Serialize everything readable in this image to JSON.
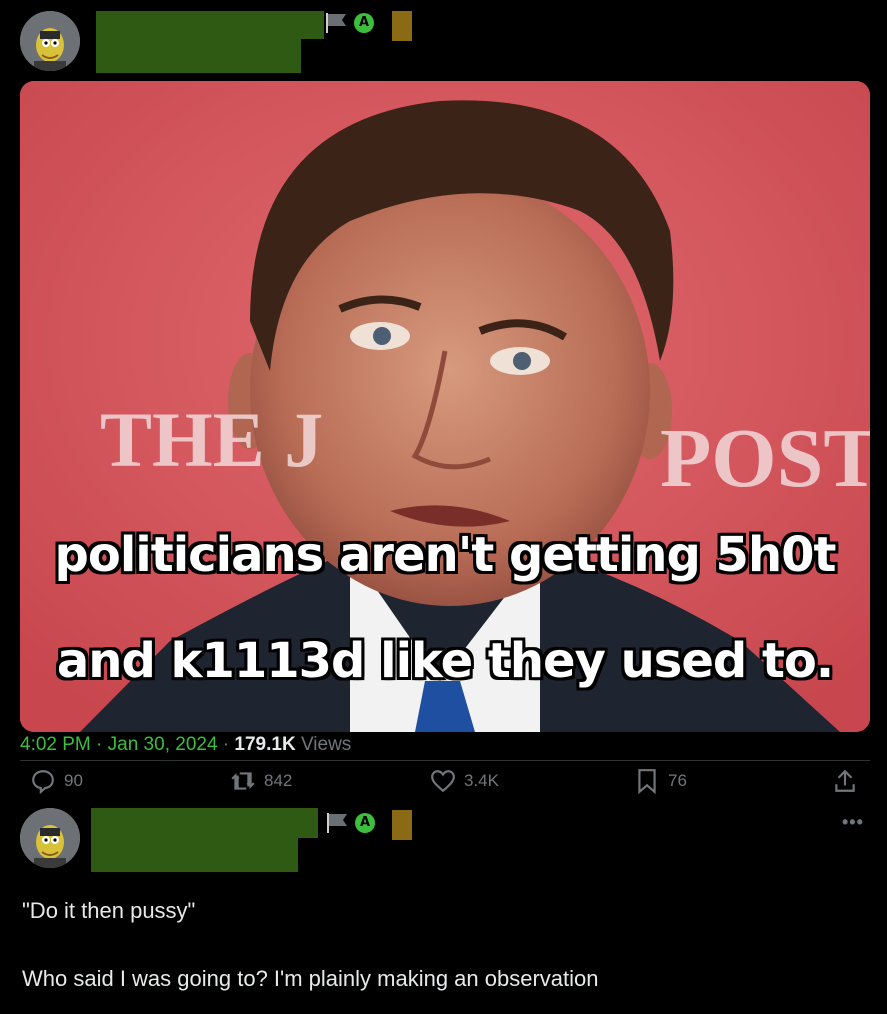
{
  "tweet": {
    "caption_line_1": "politicians aren't getting 5h0t",
    "caption_line_2": "and k1113d like they used to.",
    "timestamp": "4:02 PM · Jan 30, 2024",
    "views_count": "179.1K",
    "views_label": "Views",
    "photo_backdrop_text_left": "THE J",
    "photo_backdrop_text_right": "POST",
    "actions": {
      "replies": "90",
      "reposts": "842",
      "likes": "3.4K",
      "bookmarks": "76"
    }
  },
  "reply": {
    "line_1": "\"Do it then pussy\"",
    "line_2": "Who said I was going to? I'm plainly making an observation"
  },
  "icons": {
    "flag": "flag-icon",
    "anarchy": "anarchy-a-icon",
    "reply": "speech-bubble-icon",
    "repost": "repost-arrows-icon",
    "like": "heart-icon",
    "bookmark": "bookmark-icon",
    "share": "share-upload-icon",
    "more": "more-dots-icon"
  },
  "colors": {
    "background": "#000000",
    "accent_green": "#3dbd3d",
    "muted": "#71767b",
    "redaction": "#2f5a14",
    "photo_backdrop": "#d4555b"
  }
}
